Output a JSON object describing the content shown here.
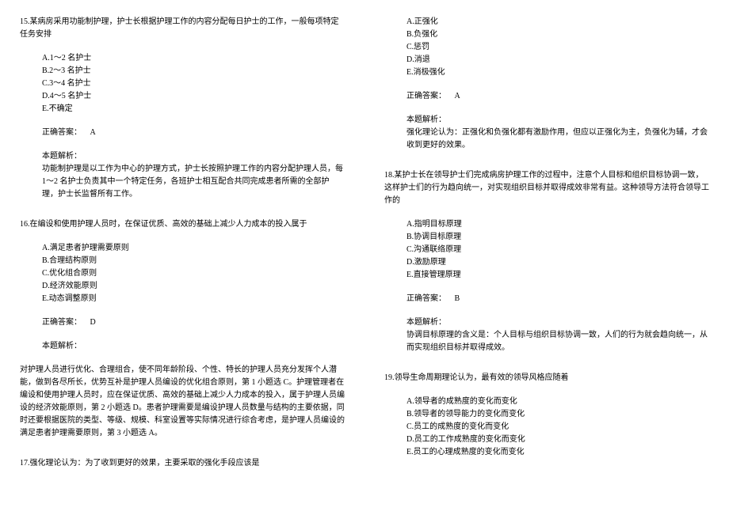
{
  "col1": {
    "q15": {
      "text": "15.某病房采用功能制护理，护士长根据护理工作的内容分配每日护士的工作，一般每项特定任务安排",
      "options": {
        "a": "A.1～2 名护士",
        "b": "B.2～3 名护士",
        "c": "C.3～4 名护士",
        "d": "D.4～5 名护士",
        "e": "E.不确定"
      },
      "answer_label": "正确答案：",
      "answer": "A",
      "analysis_label": "本题解析：",
      "analysis": "功能制护理是以工作为中心的护理方式，护士长按照护理工作的内容分配护理人员，每 1～2 名护士负责其中一个特定任务，各班护士相互配合共同完成患者所需的全部护理，护士长监督所有工作。"
    },
    "q16": {
      "text": "16.在编设和使用护理人员时，在保证优质、高效的基础上减少人力成本的投入属于",
      "options": {
        "a": "A.满足患者护理需要原则",
        "b": "B.合理结构原则",
        "c": "C.优化组合原则",
        "d": "D.经济效能原则",
        "e": "E.动态调整原则"
      },
      "answer_label": "正确答案：",
      "answer": "D",
      "analysis_label": "本题解析：",
      "analysis": "对护理人员进行优化、合理组合，使不同年龄阶段、个性、特长的护理人员充分发挥个人潜能，做到各尽所长，优势互补是护理人员编设的优化组合原则，第 1 小题选 C。护理管理者在编设和使用护理人员时，应在保证优质、高效的基础上减少人力成本的投入，属于护理人员编设的经济效能原则，第 2 小题选 D。患者护理需要是编设护理人员数量与结构的主要依据，同时还要根据医院的类型、等级、规模、科室设置等实际情况进行综合考虑，是护理人员编设的满足患者护理需要原则，第 3 小题选 A。"
    },
    "q17": {
      "text": "17.强化理论认为：为了收到更好的效果，主要采取的强化手段应该是"
    }
  },
  "col2": {
    "q17_continued": {
      "options": {
        "a": "A.正强化",
        "b": "B.负强化",
        "c": "C.惩罚",
        "d": "D.消退",
        "e": "E.消极强化"
      },
      "answer_label": "正确答案：",
      "answer": "A",
      "analysis_label": "本题解析：",
      "analysis": "强化理论认为：正强化和负强化都有激励作用，但应以正强化为主，负强化为辅，才会收到更好的效果。"
    },
    "q18": {
      "text": "18.某护士长在领导护士们完成病房护理工作的过程中，注意个人目标和组织目标协调一致，这样护士们的行为趋向统一，对实现组织目标并取得成效非常有益。这种领导方法符合领导工作的",
      "options": {
        "a": "A.指明目标原理",
        "b": "B.协调目标原理",
        "c": "C.沟通联络原理",
        "d": "D.激励原理",
        "e": "E.直接管理原理"
      },
      "answer_label": "正确答案：",
      "answer": "B",
      "analysis_label": "本题解析：",
      "analysis": "协调目标原理的含义是：个人目标与组织目标协调一致，人们的行为就会趋向统一，从而实现组织目标并取得成效。"
    },
    "q19": {
      "text": "19.领导生命周期理论认为，最有效的领导风格应随着",
      "options": {
        "a": "A.领导者的成熟度的变化而变化",
        "b": "B.领导者的领导能力的变化而变化",
        "c": "C.员工的成熟度的变化而变化",
        "d": "D.员工的工作成熟度的变化而变化",
        "e": "E.员工的心理成熟度的变化而变化"
      }
    }
  }
}
